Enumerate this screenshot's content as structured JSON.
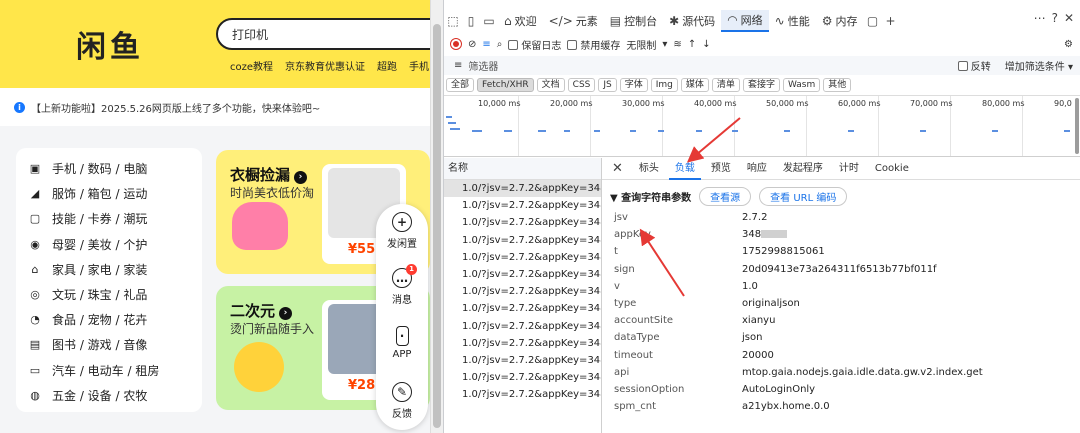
{
  "web": {
    "logo": "闲鱼",
    "search_value": "打印机",
    "quick_links": [
      "coze教程",
      "京东教育优惠认证",
      "超跑",
      "手机"
    ],
    "notice": "【上新功能啦】2025.5.26网页版上线了多个功能，快来体验吧~",
    "categories": [
      {
        "icon": "phone-icon",
        "label": "手机 / 数码 / 电脑"
      },
      {
        "icon": "shoe-icon",
        "label": "服饰 / 箱包 / 运动"
      },
      {
        "icon": "bag-icon",
        "label": "技能 / 卡券 / 潮玩"
      },
      {
        "icon": "baby-icon",
        "label": "母婴 / 美妆 / 个护"
      },
      {
        "icon": "lamp-icon",
        "label": "家具 / 家电 / 家装"
      },
      {
        "icon": "gem-icon",
        "label": "文玩 / 珠宝 / 礼品"
      },
      {
        "icon": "food-icon",
        "label": "食品 / 宠物 / 花卉"
      },
      {
        "icon": "book-icon",
        "label": "图书 / 游戏 / 音像"
      },
      {
        "icon": "car-icon",
        "label": "汽车 / 电动车 / 租房"
      },
      {
        "icon": "tool-icon",
        "label": "五金 / 设备 / 农牧"
      }
    ],
    "promo_a": {
      "title": "衣橱捡漏",
      "subtitle": "时尚美衣低价淘",
      "price": "¥55."
    },
    "promo_b": {
      "title": "二次元",
      "subtitle": "烫门新品随手入",
      "price": "¥28"
    },
    "float": {
      "post": "发闲置",
      "message": "消息",
      "message_badge": "1",
      "app": "APP",
      "feedback": "反馈"
    }
  },
  "devtools": {
    "tabs": [
      {
        "icon": "home-icon",
        "label": "欢迎"
      },
      {
        "icon": "code-icon",
        "label": "元素"
      },
      {
        "icon": "console-icon",
        "label": "控制台"
      },
      {
        "icon": "bug-icon",
        "label": "源代码"
      },
      {
        "icon": "wifi-icon",
        "label": "网络"
      },
      {
        "icon": "perf-icon",
        "label": "性能"
      },
      {
        "icon": "memory-icon",
        "label": "内存"
      }
    ],
    "toolbar": {
      "preserve_log": "保留日志",
      "disable_cache": "禁用缓存",
      "throttling": "无限制"
    },
    "filter": {
      "placeholder": "筛选器",
      "invert": "反转",
      "more_filters": "增加筛选条件"
    },
    "types": [
      "全部",
      "Fetch/XHR",
      "文档",
      "CSS",
      "JS",
      "字体",
      "Img",
      "媒体",
      "清单",
      "套接字",
      "Wasm",
      "其他"
    ],
    "timeline_ticks": [
      "10,000 ms",
      "20,000 ms",
      "30,000 ms",
      "40,000 ms",
      "50,000 ms",
      "60,000 ms",
      "70,000 ms",
      "80,000 ms",
      "90,0"
    ],
    "requests_header": "名称",
    "requests": [
      "1.0/?jsv=2.7.2&appKey=348...",
      "1.0/?jsv=2.7.2&appKey=348...",
      "1.0/?jsv=2.7.2&appKey=348...",
      "1.0/?jsv=2.7.2&appKey=348...",
      "1.0/?jsv=2.7.2&appKey=348...",
      "1.0/?jsv=2.7.2&appKey=348...",
      "1.0/?jsv=2.7.2&appKey=348...",
      "1.0/?jsv=2.7.2&appKey=348...",
      "1.0/?jsv=2.7.2&appKey=348...",
      "1.0/?jsv=2.7.2&appKey=348...",
      "1.0/?jsv=2.7.2&appKey=348...",
      "1.0/?jsv=2.7.2&appKey=348...",
      "1.0/?jsv=2.7.2&appKey=348..."
    ],
    "detail_tabs": [
      "标头",
      "负载",
      "预览",
      "响应",
      "发起程序",
      "计时",
      "Cookie"
    ],
    "active_detail_tab": "负载",
    "section_title": "▼ 查询字符串参数",
    "view_source": "查看源",
    "view_url_encoded": "查看 URL 编码",
    "params": [
      {
        "key": "jsv",
        "value": "2.7.2"
      },
      {
        "key": "appKey",
        "value": "348"
      },
      {
        "key": "t",
        "value": "1752998815061"
      },
      {
        "key": "sign",
        "value": "20d09413e73a264311f6513b77bf011f"
      },
      {
        "key": "v",
        "value": "1.0"
      },
      {
        "key": "type",
        "value": "originaljson"
      },
      {
        "key": "accountSite",
        "value": "xianyu"
      },
      {
        "key": "dataType",
        "value": "json"
      },
      {
        "key": "timeout",
        "value": "20000"
      },
      {
        "key": "api",
        "value": "mtop.gaia.nodejs.gaia.idle.data.gw.v2.index.get"
      },
      {
        "key": "sessionOption",
        "value": "AutoLoginOnly"
      },
      {
        "key": "spm_cnt",
        "value": "a21ybx.home.0.0"
      }
    ]
  },
  "colors": {
    "brand_yellow": "#ffe64a",
    "devtools_accent": "#1a73e8",
    "annotation_arrow": "#e53935"
  }
}
